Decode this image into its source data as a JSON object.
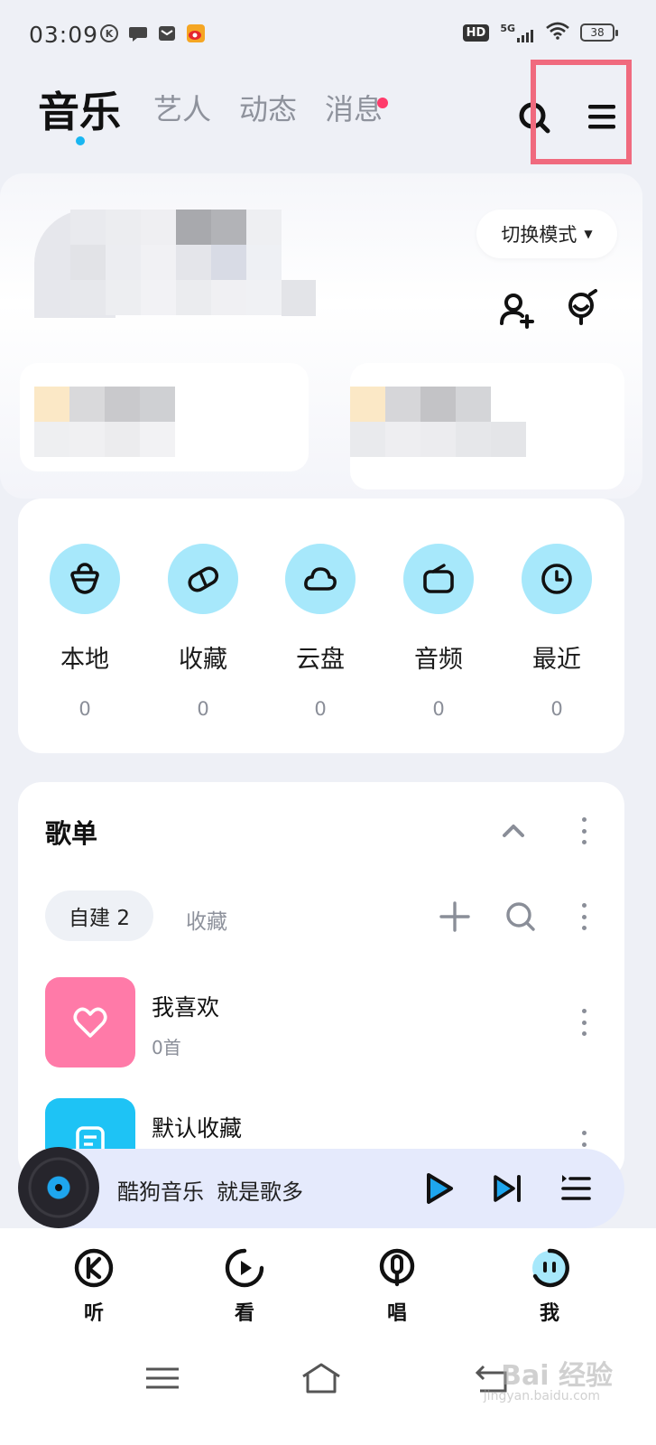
{
  "status_bar": {
    "time": "03:09",
    "network": "5G",
    "hd": "HD",
    "battery": "38"
  },
  "top_tabs": {
    "active": "音乐",
    "tabs": [
      "艺人",
      "动态",
      "消息"
    ],
    "has_message_dot": true
  },
  "profile": {
    "switch_mode_label": "切换模式",
    "blurred": true
  },
  "quick_access": [
    {
      "label": "本地",
      "count": "0",
      "icon": "bag-icon"
    },
    {
      "label": "收藏",
      "count": "0",
      "icon": "pill-heart-icon"
    },
    {
      "label": "云盘",
      "count": "0",
      "icon": "cloud-icon"
    },
    {
      "label": "音频",
      "count": "0",
      "icon": "radio-icon"
    },
    {
      "label": "最近",
      "count": "0",
      "icon": "clock-icon"
    }
  ],
  "playlists": {
    "title": "歌单",
    "sub_tabs": {
      "created": "自建 2",
      "favorites": "收藏"
    },
    "items": [
      {
        "name": "我喜欢",
        "count": "0首",
        "cover_color": "#ff7aa8",
        "icon": "heart-icon"
      },
      {
        "name": "默认收藏",
        "count": "",
        "cover_color": "#1ec3f5",
        "icon": "document-icon"
      }
    ]
  },
  "mini_player": {
    "title": "酷狗音乐",
    "subtitle": "就是歌多"
  },
  "bottom_nav": [
    {
      "label": "听",
      "icon": "k-logo-icon"
    },
    {
      "label": "看",
      "icon": "play-circle-icon"
    },
    {
      "label": "唱",
      "icon": "microphone-icon"
    },
    {
      "label": "我",
      "icon": "face-icon"
    }
  ],
  "watermark": {
    "text": "Bai 经验",
    "sub": "jingyan.baidu.com"
  },
  "colors": {
    "accent": "#19b6f1",
    "quick_circle": "#a7e8fb",
    "highlight": "#f06a7e",
    "mini_player_bg": "#e5eafc"
  }
}
